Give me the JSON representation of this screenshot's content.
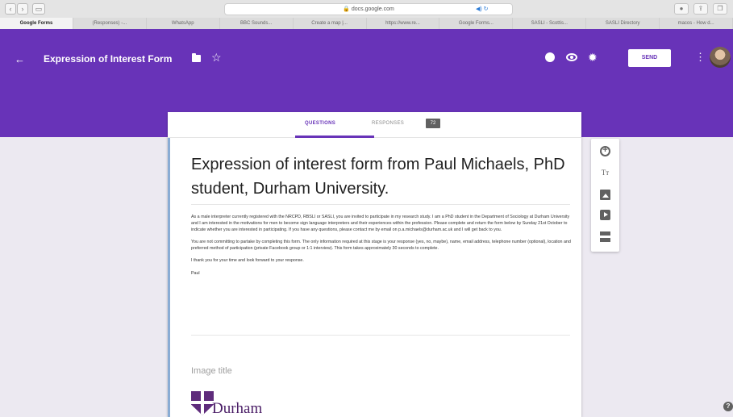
{
  "browser": {
    "url": "docs.google.com",
    "tabs": [
      {
        "label": "Google Forms",
        "active": true
      },
      {
        "label": "(Responses) -...",
        "active": false
      },
      {
        "label": "WhatsApp",
        "active": false
      },
      {
        "label": "BBC Sounds...",
        "active": false
      },
      {
        "label": "Create a map |...",
        "active": false
      },
      {
        "label": "https://www.re...",
        "active": false
      },
      {
        "label": "Google Forms...",
        "active": false
      },
      {
        "label": "SASLI - Scottis...",
        "active": false
      },
      {
        "label": "SASLI Directory",
        "active": false
      },
      {
        "label": "macos - How d...",
        "active": false
      }
    ]
  },
  "header": {
    "title": "Expression of Interest Form",
    "send_label": "SEND",
    "accent": "#6833b8"
  },
  "card": {
    "tab_questions": "QUESTIONS",
    "tab_responses": "RESPONSES",
    "responses_count": "72"
  },
  "form": {
    "heading": "Expression of interest form from Paul Michaels, PhD student, Durham University.",
    "paragraphs": [
      "As a male interpreter currently registered with the NRCPD, RBSLI or SASLI, you are invited to participate in my research study. I am a PhD student in the Department of Sociology at Durham University and I am interested in the motivations for men to become sign language interpreters and their experiences within the profession. Please complete and return the form below by Sunday 21st October to indicate whether you are interested in participating. If you have any questions, please contact me by email on p.a.michaels@durham.ac.uk and I will get back to you.",
      "You are not committing to partake by completing this form. The only information required at this stage is your response (yes, no, maybe), name, email address, telephone number (optional), location and preferred method of participation (private Facebook group or 1:1 interview). This form takes approximately 30 seconds to complete.",
      "I thank you for your time and look forward to your response.",
      "Paul"
    ],
    "image_title": "Image title",
    "logo_text": "Durham"
  },
  "sidebar": {
    "title_icon_glyph": "Tт"
  },
  "help_glyph": "?"
}
